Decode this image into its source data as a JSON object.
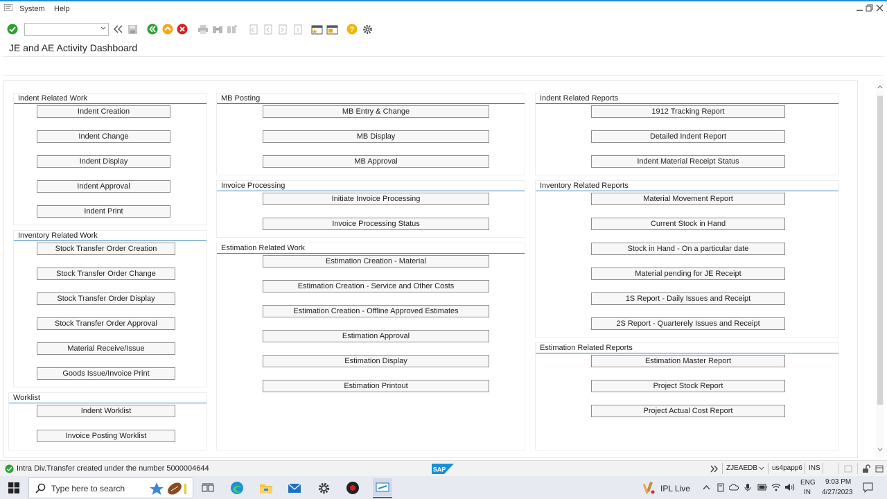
{
  "menu": {
    "system": "System",
    "help": "Help"
  },
  "toolbar": {
    "command_value": "",
    "command_placeholder": ""
  },
  "title": "JE and AE Activity Dashboard",
  "groups": {
    "indent_work": {
      "title": "Indent Related Work",
      "buttons": [
        "Indent Creation",
        "Indent Change",
        "Indent Display",
        "Indent Approval",
        "Indent Print"
      ]
    },
    "inventory_work": {
      "title": "Inventory Related Work",
      "buttons": [
        "Stock Transfer Order Creation",
        "Stock Transfer Order Change",
        "Stock Transfer Order Display",
        "Stock Transfer Order Approval",
        "Material Receive/Issue",
        "Goods Issue/Invoice Print"
      ]
    },
    "worklist": {
      "title": "Worklist",
      "buttons": [
        "Indent Worklist",
        "Invoice Posting Worklist"
      ]
    },
    "mb_posting": {
      "title": "MB Posting",
      "buttons": [
        "MB Entry & Change",
        "MB Display",
        "MB Approval"
      ]
    },
    "invoice_processing": {
      "title": "Invoice Processing",
      "buttons": [
        "Initiate Invoice Processing",
        "Invoice Processing Status"
      ]
    },
    "estimation_work": {
      "title": "Estimation Related Work",
      "buttons": [
        "Estimation Creation - Material",
        "Estimation Creation - Service and Other Costs",
        "Estimation Creation - Offline Approved Estimates",
        "Estimation Approval",
        "Estimation Display",
        "Estimation Printout"
      ]
    },
    "indent_reports": {
      "title": "Indent Related Reports",
      "buttons": [
        "1912 Tracking Report",
        "Detailed Indent Report",
        "Indent Material Receipt Status"
      ]
    },
    "inventory_reports": {
      "title": "Inventory Related Reports",
      "buttons": [
        "Material Movement Report",
        "Current Stock in Hand",
        "Stock in Hand - On a particular date",
        "Material pending for JE Receipt",
        "1S Report - Daily Issues and Receipt",
        "2S Report - Quarterely Issues and Receipt"
      ]
    },
    "estimation_reports": {
      "title": "Estimation Related Reports",
      "buttons": [
        "Estimation Master Report",
        "Project Stock Report",
        "Project Actual Cost Report"
      ]
    }
  },
  "statusbar": {
    "message": "Intra Div.Transfer created under the number 5000004644",
    "logo": "SAP",
    "system": "ZJEAEDB",
    "server": "us4papp6",
    "mode": "INS"
  },
  "taskbar": {
    "search_placeholder": "Type here to search",
    "ipl_label": "IPL Live",
    "lang_top": "ENG",
    "lang_bottom": "IN",
    "time": "9:03 PM",
    "date": "4/27/2023"
  },
  "colors": {
    "accent_line": "#2f7ec1",
    "success": "#2aa130",
    "status_bg": "#f2f2f2",
    "taskbar_bg": "#e7eaf1"
  }
}
